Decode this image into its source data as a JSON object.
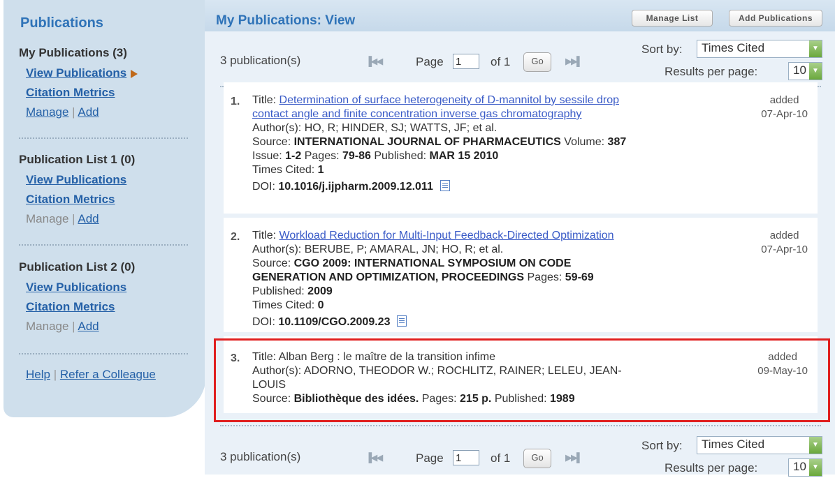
{
  "sidebar": {
    "title": "Publications",
    "sections": [
      {
        "head": "My Publications (3)",
        "view": "View Publications",
        "metrics": "Citation Metrics",
        "manage": "Manage",
        "sep": "|",
        "add": "Add"
      },
      {
        "head": "Publication List 1 (0)",
        "view": "View Publications",
        "metrics": "Citation Metrics",
        "manage": "Manage",
        "sep": "|",
        "add": "Add"
      },
      {
        "head": "Publication List 2 (0)",
        "view": "View Publications",
        "metrics": "Citation Metrics",
        "manage": "Manage",
        "sep": "|",
        "add": "Add"
      }
    ],
    "help": "Help",
    "help_sep": "|",
    "refer": "Refer a Colleague"
  },
  "header": {
    "title": "My Publications: View",
    "manage_list": "Manage List",
    "add_publications": "Add Publications"
  },
  "pager": {
    "count": "3 publication(s)",
    "page_label": "Page",
    "page_value": "1",
    "of_label": "of 1",
    "go": "Go",
    "sort_label": "Sort by:",
    "sort_value": "Times Cited",
    "rpp_label": "Results per page:",
    "rpp_value": "10"
  },
  "records": [
    {
      "num": "1.",
      "title_label": "Title:",
      "title_line1": "Determination of surface heterogeneity of D-mannitol by sessile drop",
      "title_line2": "contact angle and finite concentration inverse gas chromatography",
      "authors": "Author(s): HO, R; HINDER, SJ; WATTS, JF; et al.",
      "source_label": "Source:",
      "source": "INTERNATIONAL JOURNAL OF PHARMACEUTICS",
      "volume_label": "Volume:",
      "volume": "387",
      "issue_label": "Issue:",
      "issue": "1-2",
      "pages_label": "Pages:",
      "pages": "79-86",
      "published_label": "Published:",
      "published": "MAR 15 2010",
      "cited_label": "Times Cited:",
      "cited": "1",
      "doi_label": "DOI:",
      "doi": "10.1016/j.ijpharm.2009.12.011",
      "added_label": "added",
      "added_date": "07-Apr-10"
    },
    {
      "num": "2.",
      "title_label": "Title:",
      "title_line1": "Workload Reduction for Multi-Input Feedback-Directed Optimization",
      "authors": "Author(s): BERUBE, P; AMARAL, JN; HO, R; et al.",
      "source_label": "Source:",
      "source_line1": "CGO 2009: INTERNATIONAL SYMPOSIUM ON CODE",
      "source_line2": "GENERATION AND OPTIMIZATION, PROCEEDINGS",
      "pages_label": "Pages:",
      "pages": "59-69",
      "published_label": "Published:",
      "published": "2009",
      "cited_label": "Times Cited:",
      "cited": "0",
      "doi_label": "DOI:",
      "doi": "10.1109/CGO.2009.23",
      "added_label": "added",
      "added_date": "07-Apr-10"
    },
    {
      "num": "3.",
      "title": "Title: Alban Berg : le maître de la transition infime",
      "authors_line1": "Author(s): ADORNO, THEODOR W.; ROCHLITZ, RAINER; LELEU, JEAN-",
      "authors_line2": "LOUIS",
      "source_label": "Source:",
      "source": "Bibliothèque des idées.",
      "pages_label": "Pages:",
      "pages": "215 p.",
      "published_label": "Published:",
      "published": "1989",
      "added_label": "added",
      "added_date": "09-May-10"
    }
  ],
  "colors": {
    "accent": "#2f73b8",
    "link": "#2460a7",
    "highlight": "#e01f1f",
    "sidebar_bg": "#cfdfec"
  },
  "icons": {
    "first": "first-page-icon",
    "prev": "prev-page-icon",
    "next": "next-page-icon",
    "last": "last-page-icon",
    "doc": "document-icon",
    "arrow": "current-arrow-icon"
  }
}
